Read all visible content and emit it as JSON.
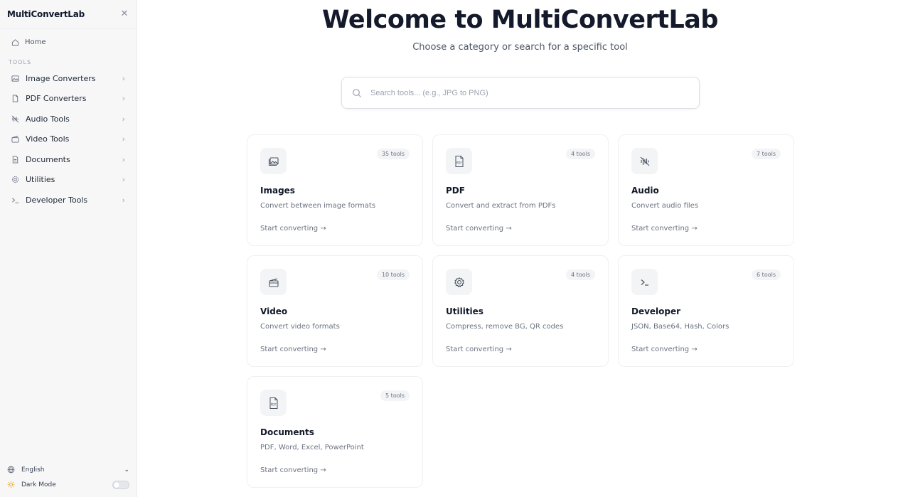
{
  "sidebar": {
    "brand": "MultiConvertLab",
    "home": "Home",
    "section": "TOOLS",
    "items": [
      {
        "label": "Image Converters",
        "icon": "image-icon"
      },
      {
        "label": "PDF Converters",
        "icon": "pdf-icon"
      },
      {
        "label": "Audio Tools",
        "icon": "audio-icon"
      },
      {
        "label": "Video Tools",
        "icon": "video-icon"
      },
      {
        "label": "Documents",
        "icon": "document-icon"
      },
      {
        "label": "Utilities",
        "icon": "gear-icon"
      },
      {
        "label": "Developer Tools",
        "icon": "terminal-icon"
      }
    ],
    "language": "English",
    "dark_mode": "Dark Mode"
  },
  "main": {
    "title": "Welcome to MultiConvertLab",
    "subtitle": "Choose a category or search for a specific tool",
    "search_placeholder": "Search tools... (e.g., JPG to PNG)",
    "cta": "Start converting",
    "cards": [
      {
        "name": "Images",
        "desc": "Convert between image formats",
        "badge": "35 tools",
        "icon": "image-icon"
      },
      {
        "name": "PDF",
        "desc": "Convert and extract from PDFs",
        "badge": "4 tools",
        "icon": "pdf-icon"
      },
      {
        "name": "Audio",
        "desc": "Convert audio files",
        "badge": "7 tools",
        "icon": "audio-icon"
      },
      {
        "name": "Video",
        "desc": "Convert video formats",
        "badge": "10 tools",
        "icon": "video-icon"
      },
      {
        "name": "Utilities",
        "desc": "Compress, remove BG, QR codes",
        "badge": "4 tools",
        "icon": "gear-icon"
      },
      {
        "name": "Developer",
        "desc": "JSON, Base64, Hash, Colors",
        "badge": "6 tools",
        "icon": "terminal-icon"
      },
      {
        "name": "Documents",
        "desc": "PDF, Word, Excel, PowerPoint",
        "badge": "5 tools",
        "icon": "pdf-icon"
      }
    ]
  }
}
